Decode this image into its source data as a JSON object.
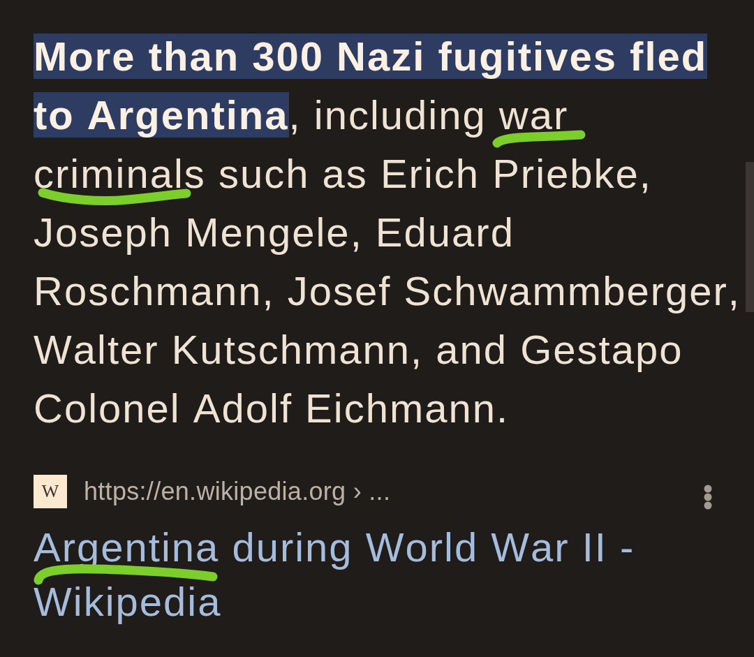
{
  "snippet": {
    "text": "**More than 300 Nazi fugitives fled to Argentina**, including war criminals such as Erich Priebke, Joseph Mengele, Eduard Roschmann, Josef Schwammberger, Walter Kutschmann, and Gestapo Colonel Adolf Eichmann."
  },
  "result": {
    "favicon": "W",
    "url": "https://en.wikipedia.org › ...",
    "title": "Argentina during World War II - Wikipedia"
  }
}
